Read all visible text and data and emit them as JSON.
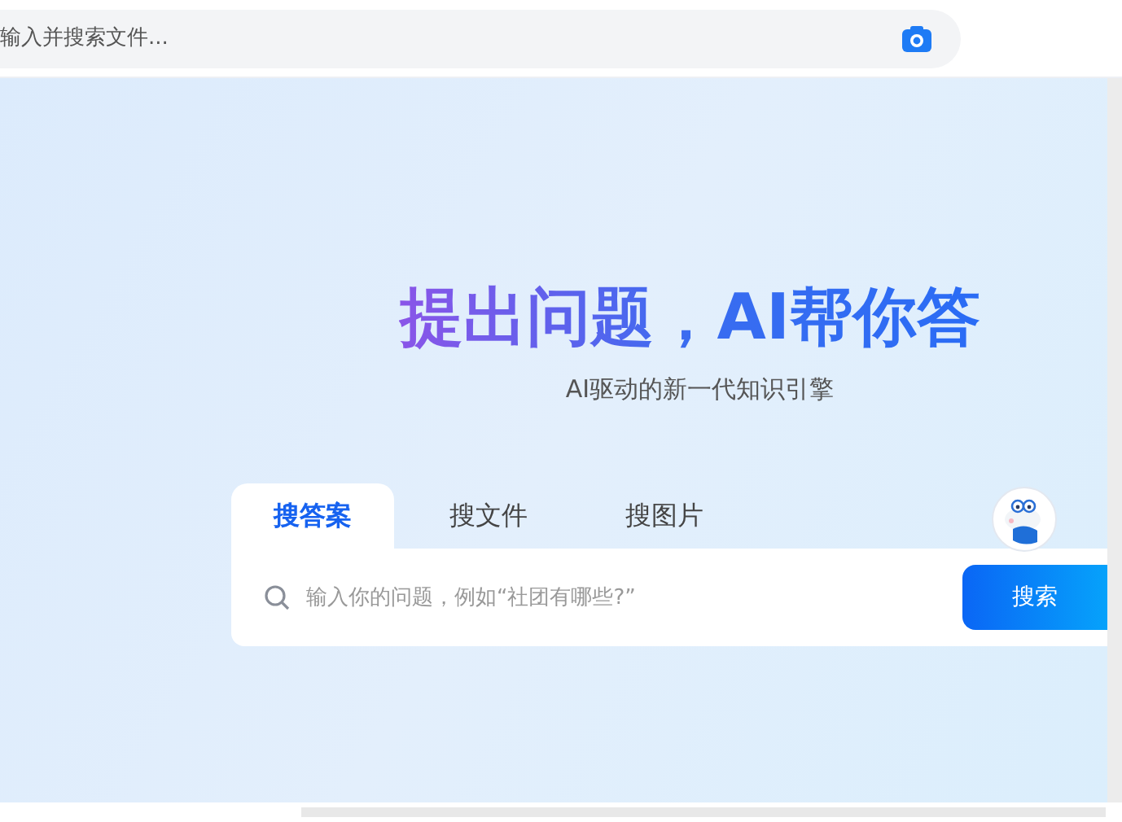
{
  "top_search": {
    "placeholder": "输入并搜索文件..."
  },
  "hero": {
    "title": "提出问题，AI帮你答",
    "subtitle": "AI驱动的新一代知识引擎"
  },
  "tabs": [
    {
      "label": "搜答案",
      "selected": true
    },
    {
      "label": "搜文件",
      "selected": false
    },
    {
      "label": "搜图片",
      "selected": false
    }
  ],
  "search": {
    "placeholder": "输入你的问题，例如“社团有哪些?”",
    "button": "搜索"
  }
}
